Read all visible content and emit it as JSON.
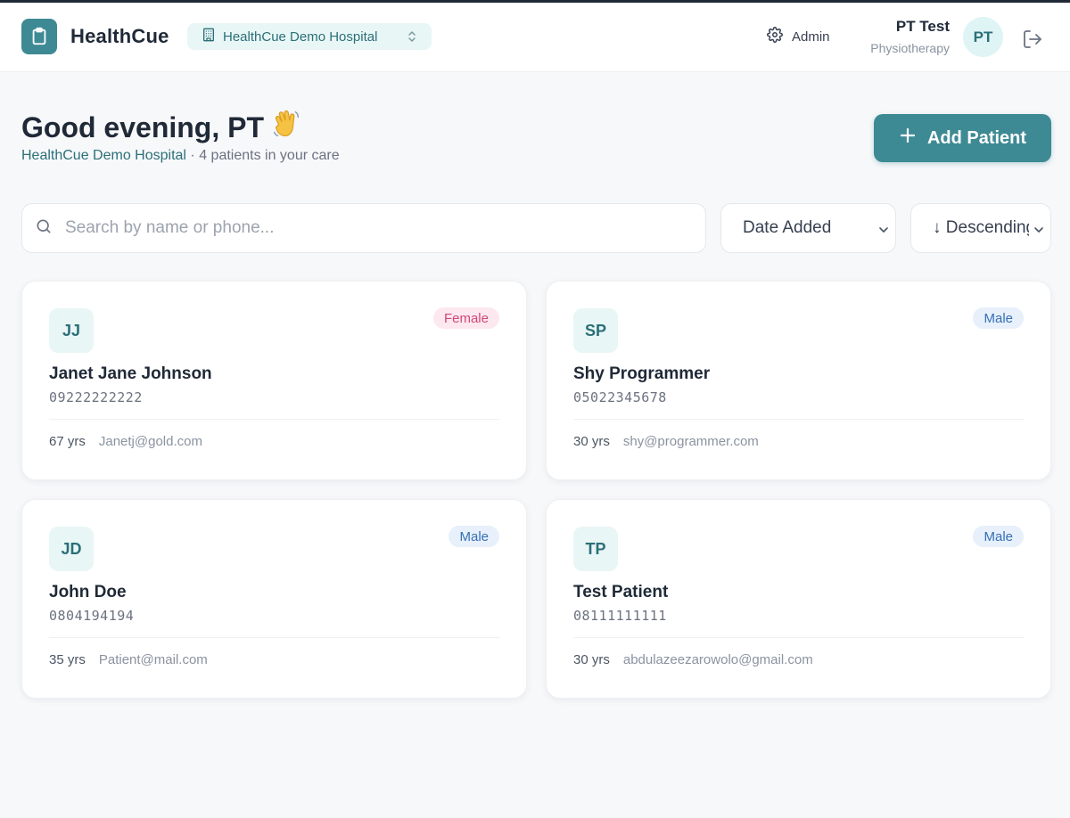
{
  "header": {
    "brand": "HealthCue",
    "hospital": "HealthCue Demo Hospital",
    "admin_label": "Admin",
    "user_name": "PT Test",
    "user_role": "Physiotherapy",
    "avatar_initials": "PT"
  },
  "greeting": {
    "title": "Good evening, PT",
    "emoji": "👋",
    "hospital": "HealthCue Demo Hospital",
    "separator": " · ",
    "summary": "4 patients in your care"
  },
  "actions": {
    "add_patient": "Add Patient"
  },
  "filters": {
    "search_placeholder": "Search by name or phone...",
    "sort_field": "Date Added",
    "sort_order": "↓ Descending"
  },
  "patients": [
    {
      "initials": "JJ",
      "name": "Janet Jane Johnson",
      "phone": "09222222222",
      "gender": "Female",
      "age": "67 yrs",
      "email": "Janetj@gold.com"
    },
    {
      "initials": "SP",
      "name": "Shy Programmer",
      "phone": "05022345678",
      "gender": "Male",
      "age": "30 yrs",
      "email": "shy@programmer.com"
    },
    {
      "initials": "JD",
      "name": "John Doe",
      "phone": "0804194194",
      "gender": "Male",
      "age": "35 yrs",
      "email": "Patient@mail.com"
    },
    {
      "initials": "TP",
      "name": "Test Patient",
      "phone": "08111111111",
      "gender": "Male",
      "age": "30 yrs",
      "email": "abdulazeezarowolo@gmail.com"
    }
  ],
  "colors": {
    "brand": "#3e8a94",
    "brand_light": "#e9f6f6",
    "female_badge": "#d0487a",
    "male_badge": "#3570b6"
  }
}
